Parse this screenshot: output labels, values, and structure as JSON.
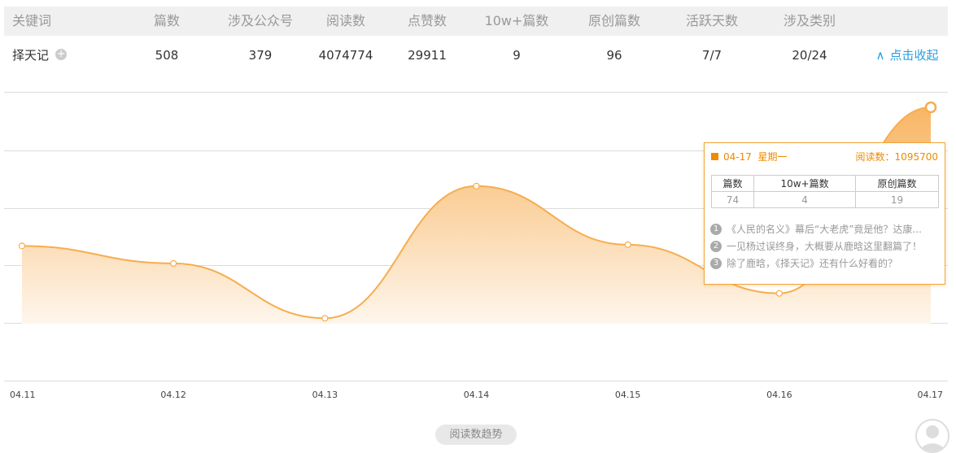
{
  "table": {
    "headers": [
      "关键词",
      "篇数",
      "涉及公众号",
      "阅读数",
      "点赞数",
      "10w+篇数",
      "原创篇数",
      "活跃天数",
      "涉及类别"
    ],
    "row": {
      "keyword": "择天记",
      "plus_icon": "plus-circle-icon",
      "values": [
        "508",
        "379",
        "4074774",
        "29911",
        "9",
        "96",
        "7/7",
        "20/24"
      ]
    },
    "collapse_label": "点击收起",
    "collapse_icon": "double-chevron-up-icon"
  },
  "chart_data": {
    "type": "area",
    "x": [
      "04.11",
      "04.12",
      "04.13",
      "04.14",
      "04.15",
      "04.16",
      "04.17"
    ],
    "y_ticks": [],
    "ylim": [
      0,
      1200000
    ],
    "series": [
      {
        "values": [
          540000,
          470000,
          250000,
          780000,
          545000,
          350000,
          1095700
        ]
      }
    ],
    "grid": "horizontal",
    "colors": {
      "line": "#f7ad4e",
      "fill_top": "#f8b25d",
      "fill_bottom": "#fef6ec",
      "grid": "#dcdcdc"
    },
    "badge_label": "阅读数趋势"
  },
  "tooltip": {
    "date": "04-17",
    "weekday": "星期一",
    "read_label": "阅读数：1095700",
    "table_headers": [
      "篇数",
      "10w+篇数",
      "原创篇数"
    ],
    "table_values": [
      "74",
      "4",
      "19"
    ],
    "articles": [
      {
        "num": "1",
        "text": "《人民的名义》幕后“大老虎”竟是他？达康..."
      },
      {
        "num": "2",
        "text": "一见杨过误终身，大概要从鹿晗这里翻篇了！"
      },
      {
        "num": "3",
        "text": "除了鹿晗，《择天记》还有什么好看的？"
      }
    ]
  },
  "avatar_icon": "user-avatar-icon"
}
